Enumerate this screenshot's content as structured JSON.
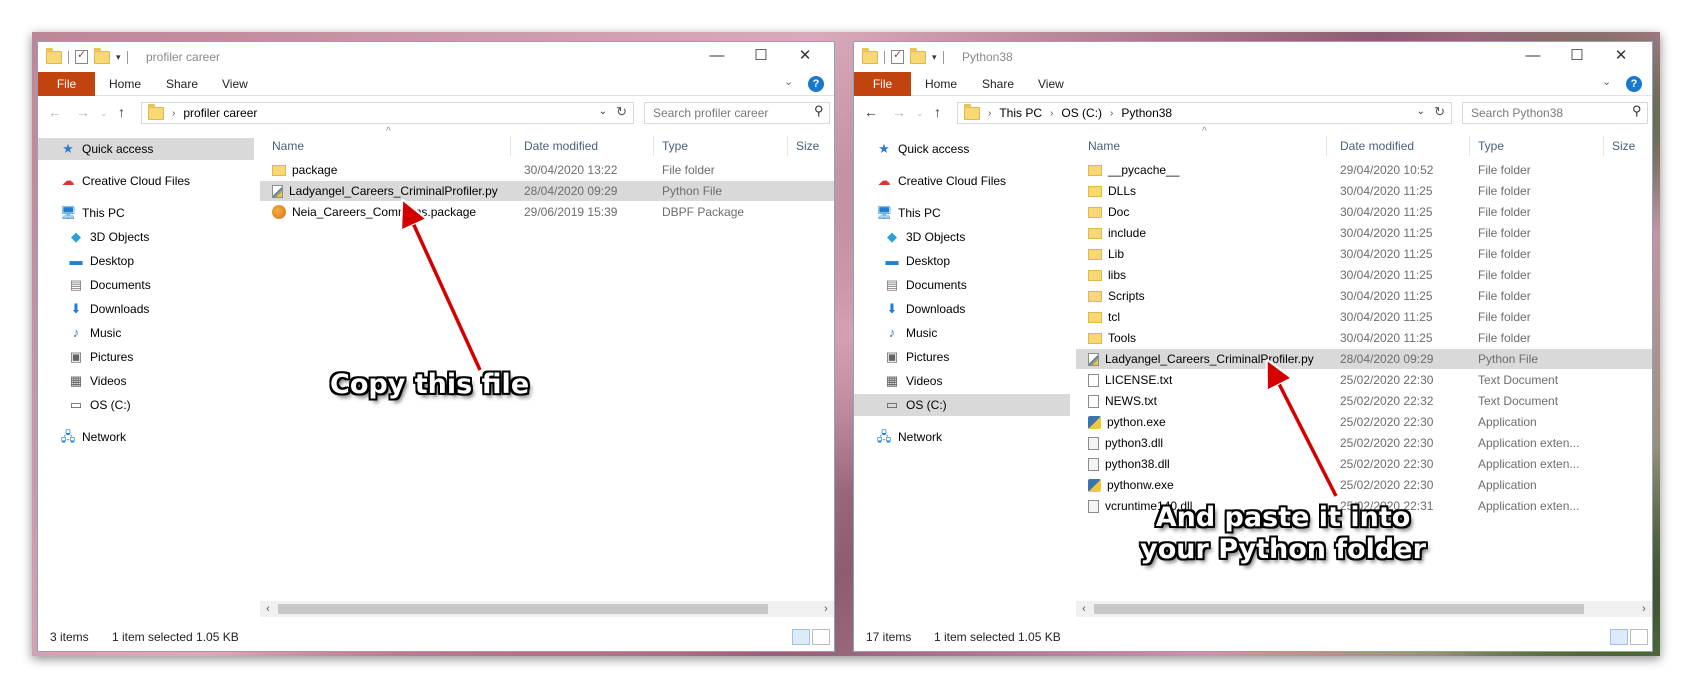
{
  "left_window": {
    "title": "profiler career",
    "ribbon": {
      "file": "File",
      "home": "Home",
      "share": "Share",
      "view": "View"
    },
    "address": [
      "profiler career"
    ],
    "search_placeholder": "Search profiler career",
    "columns": {
      "name": "Name",
      "date": "Date modified",
      "type": "Type",
      "size": "Size"
    },
    "files": [
      {
        "name": "package",
        "date": "30/04/2020 13:22",
        "type": "File folder",
        "icon": "folder-icon"
      },
      {
        "name": "Ladyangel_Careers_CriminalProfiler.py",
        "date": "28/04/2020 09:29",
        "type": "Python File",
        "icon": "python-file-icon",
        "selected": true
      },
      {
        "name": "Neia_Careers_Commons.package",
        "date": "29/06/2019 15:39",
        "type": "DBPF Package",
        "icon": "package-file-icon"
      }
    ],
    "status": {
      "items": "3 items",
      "selected": "1 item selected  1.05 KB"
    }
  },
  "right_window": {
    "title": "Python38",
    "ribbon": {
      "file": "File",
      "home": "Home",
      "share": "Share",
      "view": "View"
    },
    "address": [
      "This PC",
      "OS (C:)",
      "Python38"
    ],
    "search_placeholder": "Search Python38",
    "columns": {
      "name": "Name",
      "date": "Date modified",
      "type": "Type",
      "size": "Size"
    },
    "files": [
      {
        "name": "__pycache__",
        "date": "29/04/2020 10:52",
        "type": "File folder",
        "icon": "folder-icon"
      },
      {
        "name": "DLLs",
        "date": "30/04/2020 11:25",
        "type": "File folder",
        "icon": "folder-icon"
      },
      {
        "name": "Doc",
        "date": "30/04/2020 11:25",
        "type": "File folder",
        "icon": "folder-icon"
      },
      {
        "name": "include",
        "date": "30/04/2020 11:25",
        "type": "File folder",
        "icon": "folder-icon"
      },
      {
        "name": "Lib",
        "date": "30/04/2020 11:25",
        "type": "File folder",
        "icon": "folder-icon"
      },
      {
        "name": "libs",
        "date": "30/04/2020 11:25",
        "type": "File folder",
        "icon": "folder-icon"
      },
      {
        "name": "Scripts",
        "date": "30/04/2020 11:25",
        "type": "File folder",
        "icon": "folder-icon"
      },
      {
        "name": "tcl",
        "date": "30/04/2020 11:25",
        "type": "File folder",
        "icon": "folder-icon"
      },
      {
        "name": "Tools",
        "date": "30/04/2020 11:25",
        "type": "File folder",
        "icon": "folder-icon"
      },
      {
        "name": "Ladyangel_Careers_CriminalProfiler.py",
        "date": "28/04/2020 09:29",
        "type": "Python File",
        "icon": "python-file-icon",
        "selected": true
      },
      {
        "name": "LICENSE.txt",
        "date": "25/02/2020 22:30",
        "type": "Text Document",
        "icon": "text-file-icon"
      },
      {
        "name": "NEWS.txt",
        "date": "25/02/2020 22:32",
        "type": "Text Document",
        "icon": "text-file-icon"
      },
      {
        "name": "python.exe",
        "date": "25/02/2020 22:30",
        "type": "Application",
        "icon": "python-exe-icon"
      },
      {
        "name": "python3.dll",
        "date": "25/02/2020 22:30",
        "type": "Application exten...",
        "icon": "dll-file-icon"
      },
      {
        "name": "python38.dll",
        "date": "25/02/2020 22:30",
        "type": "Application exten...",
        "icon": "dll-file-icon"
      },
      {
        "name": "pythonw.exe",
        "date": "25/02/2020 22:30",
        "type": "Application",
        "icon": "python-exe-icon"
      },
      {
        "name": "vcruntime140.dll",
        "date": "25/02/2020 22:31",
        "type": "Application exten...",
        "icon": "dll-file-icon"
      }
    ],
    "status": {
      "items": "17 items",
      "selected": "1 item selected  1.05 KB"
    }
  },
  "nav_pane": [
    {
      "label": "Quick access",
      "icon": "star-icon"
    },
    {
      "label": "Creative Cloud Files",
      "icon": "creative-cloud-icon"
    },
    {
      "label": "This PC",
      "icon": "computer-icon"
    },
    {
      "label": "3D Objects",
      "icon": "cube-icon"
    },
    {
      "label": "Desktop",
      "icon": "desktop-icon"
    },
    {
      "label": "Documents",
      "icon": "documents-icon"
    },
    {
      "label": "Downloads",
      "icon": "download-icon"
    },
    {
      "label": "Music",
      "icon": "music-icon"
    },
    {
      "label": "Pictures",
      "icon": "pictures-icon"
    },
    {
      "label": "Videos",
      "icon": "videos-icon"
    },
    {
      "label": "OS (C:)",
      "icon": "drive-icon"
    },
    {
      "label": "Network",
      "icon": "network-icon"
    }
  ],
  "annotations": {
    "copy": "Copy this file",
    "paste_line1": "And paste it into",
    "paste_line2": "your Python folder"
  },
  "colors": {
    "file_tab": "#c1440e",
    "selection": "#d9d9d9",
    "arrow": "#d40000",
    "help": "#1979ca"
  }
}
